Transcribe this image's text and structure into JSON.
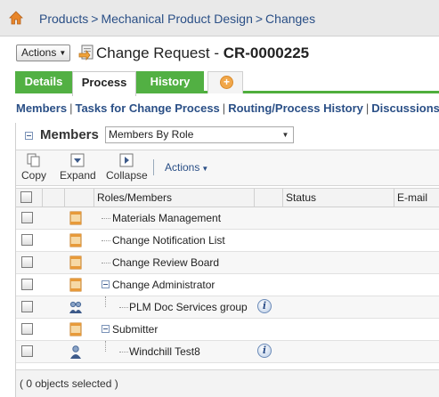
{
  "breadcrumb": {
    "items": [
      "Products",
      "Mechanical Product Design",
      "Changes"
    ],
    "separator": ">"
  },
  "header": {
    "actions_label": "Actions",
    "title_prefix": "Change Request - ",
    "title_number": "CR-0000225"
  },
  "tabs": [
    {
      "label": "Details",
      "active": false
    },
    {
      "label": "Process",
      "active": true
    },
    {
      "label": "History",
      "active": false
    }
  ],
  "add_tab_icon": "plus-icon",
  "subnav": {
    "links": [
      "Members",
      "Tasks for Change Process",
      "Routing/Process History",
      "Discussions"
    ],
    "separator": "|"
  },
  "members": {
    "title": "Members",
    "view_selected": "Members By Role"
  },
  "toolbar": {
    "copy": "Copy",
    "expand": "Expand",
    "collapse": "Collapse",
    "actions": "Actions"
  },
  "table": {
    "columns": [
      "Roles/Members",
      "Status",
      "E-mail"
    ],
    "rows": [
      {
        "name": "Materials Management",
        "icon": "role-icon",
        "expander": false,
        "info": false
      },
      {
        "name": "Change Notification List",
        "icon": "role-icon",
        "expander": false,
        "info": false
      },
      {
        "name": "Change Review Board",
        "icon": "role-icon",
        "expander": false,
        "info": false
      },
      {
        "name": "Change Administrator",
        "icon": "role-icon",
        "expander": true,
        "info": false
      },
      {
        "name": "PLM Doc Services group",
        "icon": "group-icon",
        "expander": false,
        "info": true
      },
      {
        "name": "Submitter",
        "icon": "role-icon",
        "expander": true,
        "info": false
      },
      {
        "name": "Windchill Test8",
        "icon": "user-icon",
        "expander": false,
        "info": true
      }
    ]
  },
  "footer": {
    "selection_status": "( 0 objects selected )"
  },
  "colors": {
    "tab_green": "#52b043",
    "link_blue": "#2a4f86",
    "home_orange": "#e8862a"
  }
}
